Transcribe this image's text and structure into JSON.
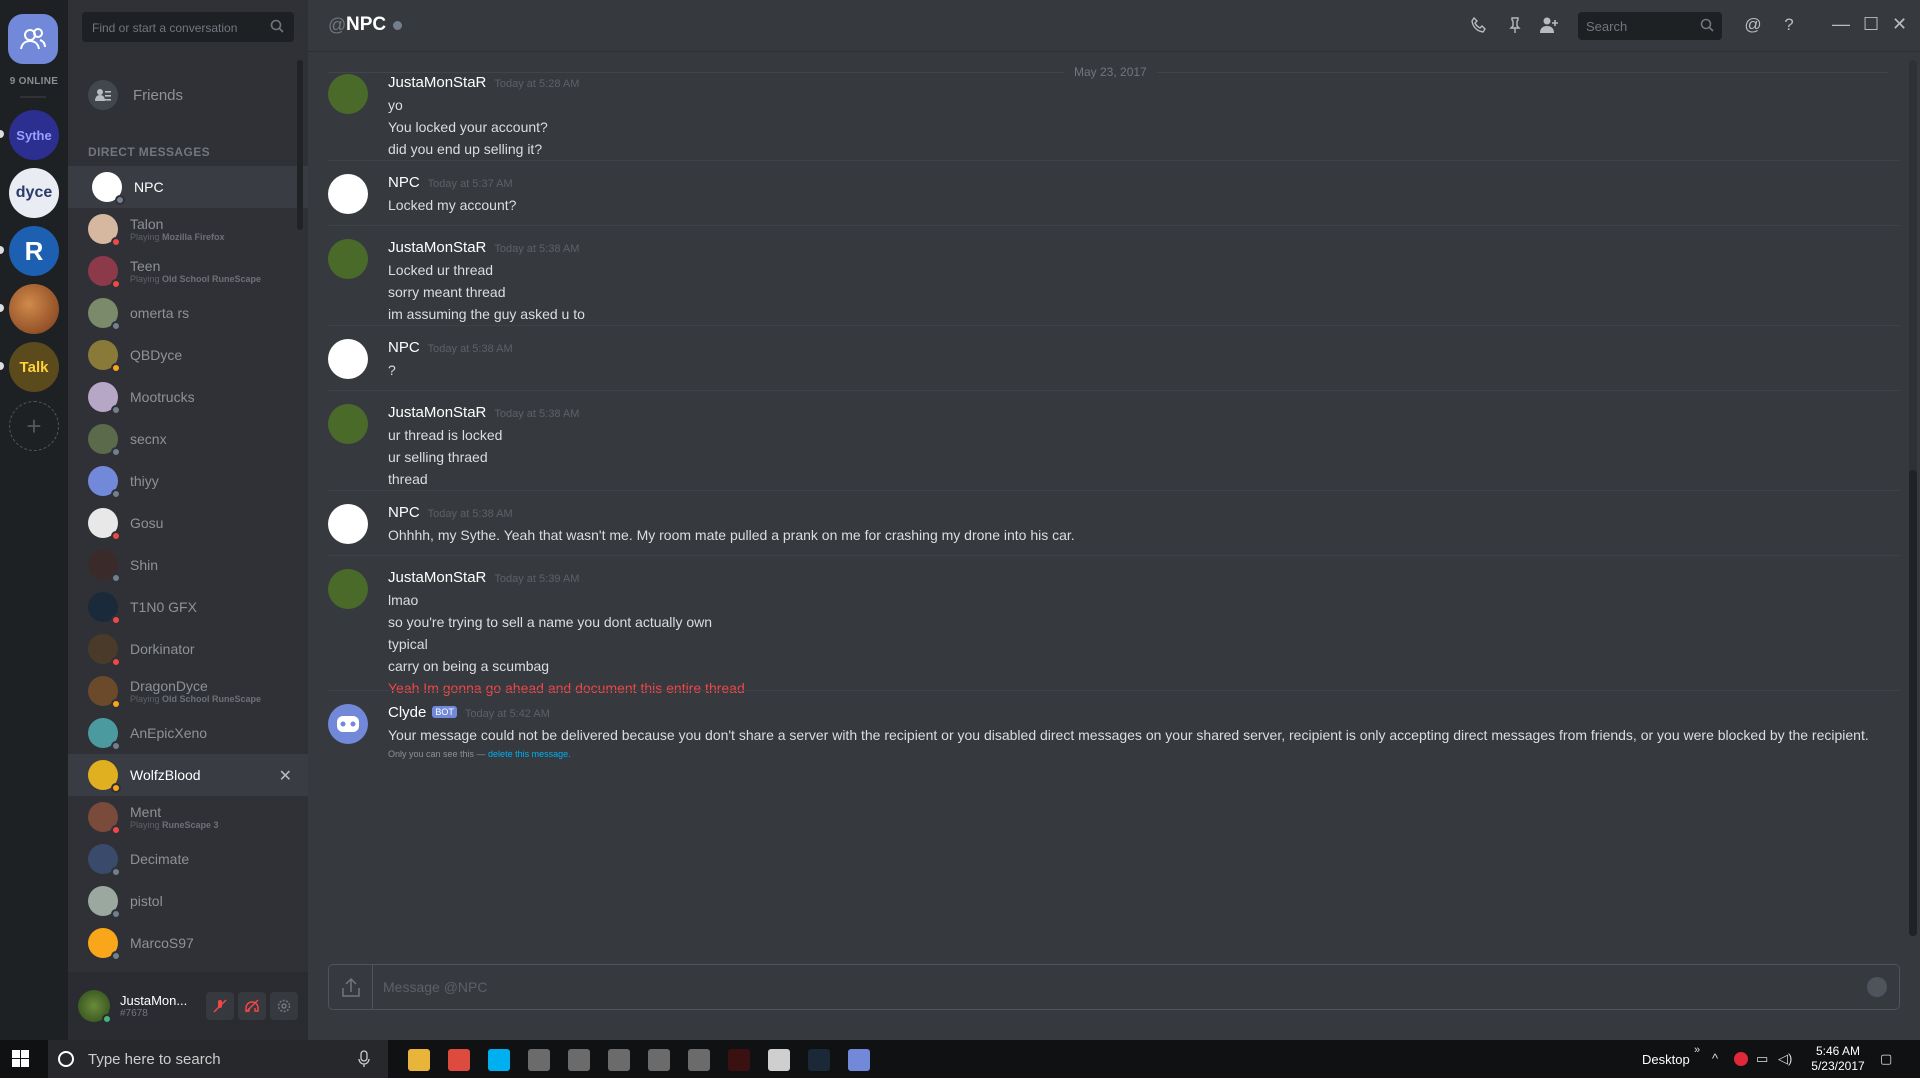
{
  "guilds": {
    "online_count": "9 ONLINE",
    "servers": [
      {
        "label": "Sythe",
        "color": "#2c2f8f"
      },
      {
        "label": "dyce",
        "color": "#e9ecf2"
      },
      {
        "label": "R",
        "color": "#1d5fb0"
      },
      {
        "label": "",
        "color": "#9b5b2c"
      },
      {
        "label": "Talk",
        "color": "#5a4a1c"
      }
    ]
  },
  "sidebar": {
    "search_placeholder": "Find or start a conversation",
    "friends_label": "Friends",
    "dm_header": "DIRECT MESSAGES",
    "dms": [
      {
        "name": "NPC",
        "sub": "",
        "game": "",
        "status": "#747f8d",
        "avatar": "#ffffff",
        "active": true
      },
      {
        "name": "Talon",
        "sub": "Playing ",
        "game": "Mozilla Firefox",
        "status": "#f04747",
        "avatar": "#d6b8a0"
      },
      {
        "name": "Teen",
        "sub": "Playing ",
        "game": "Old School RuneScape",
        "status": "#f04747",
        "avatar": "#8c3a4a"
      },
      {
        "name": "omerta rs",
        "sub": "",
        "game": "",
        "status": "#747f8d",
        "avatar": "#7a8a6a"
      },
      {
        "name": "QBDyce",
        "sub": "",
        "game": "",
        "status": "#faa61a",
        "avatar": "#8a7a3a"
      },
      {
        "name": "Mootrucks",
        "sub": "",
        "game": "",
        "status": "#747f8d",
        "avatar": "#b7a7c7"
      },
      {
        "name": "secnx",
        "sub": "",
        "game": "",
        "status": "#747f8d",
        "avatar": "#5a6a4a"
      },
      {
        "name": "thiyy",
        "sub": "",
        "game": "",
        "status": "#747f8d",
        "avatar": "#7289da"
      },
      {
        "name": "Gosu",
        "sub": "",
        "game": "",
        "status": "#f04747",
        "avatar": "#e8e8e8"
      },
      {
        "name": "Shin",
        "sub": "",
        "game": "",
        "status": "#747f8d",
        "avatar": "#3a2a2a"
      },
      {
        "name": "T1N0 GFX",
        "sub": "",
        "game": "",
        "status": "#f04747",
        "avatar": "#1a2a3a"
      },
      {
        "name": "Dorkinator",
        "sub": "",
        "game": "",
        "status": "#f04747",
        "avatar": "#4a3a2a"
      },
      {
        "name": "DragonDyce",
        "sub": "Playing ",
        "game": "Old School RuneScape",
        "status": "#faa61a",
        "avatar": "#6a4a2a"
      },
      {
        "name": "AnEpicXeno",
        "sub": "",
        "game": "",
        "status": "#747f8d",
        "avatar": "#4a9aa0"
      },
      {
        "name": "WolfzBlood",
        "sub": "",
        "game": "",
        "status": "#faa61a",
        "avatar": "#e0b020",
        "hover": true
      },
      {
        "name": "Ment",
        "sub": "Playing ",
        "game": "RuneScape 3",
        "status": "#f04747",
        "avatar": "#7a4a3a"
      },
      {
        "name": "Decimate",
        "sub": "",
        "game": "",
        "status": "#747f8d",
        "avatar": "#3a4a6a"
      },
      {
        "name": "pistol",
        "sub": "",
        "game": "",
        "status": "#747f8d",
        "avatar": "#9aa8a0"
      },
      {
        "name": "MarcoS97",
        "sub": "",
        "game": "",
        "status": "#747f8d",
        "avatar": "#faa61a"
      }
    ],
    "close_glyph": "✕"
  },
  "user_panel": {
    "name": "JustaMon...",
    "tag": "#7678"
  },
  "header": {
    "at": "@",
    "title": "NPC",
    "search_placeholder": "Search"
  },
  "date_divider": "May 23, 2017",
  "messages": [
    {
      "author": "JustaMonStaR",
      "time": "Today at 5:28 AM",
      "lines": [
        "yo",
        "You locked your account?",
        "did you end up selling it?"
      ],
      "avatar": "#4a6a2a"
    },
    {
      "author": "NPC",
      "time": "Today at 5:37 AM",
      "lines": [
        "Locked my account?"
      ],
      "avatar": "#ffffff"
    },
    {
      "author": "JustaMonStaR",
      "time": "Today at 5:38 AM",
      "lines": [
        "Locked ur thread",
        "sorry meant thread",
        "im assuming the guy asked u to"
      ],
      "avatar": "#4a6a2a"
    },
    {
      "author": "NPC",
      "time": "Today at 5:38 AM",
      "lines": [
        "?"
      ],
      "avatar": "#ffffff"
    },
    {
      "author": "JustaMonStaR",
      "time": "Today at 5:38 AM",
      "lines": [
        "ur thread is locked",
        "ur selling thraed",
        "thread"
      ],
      "avatar": "#4a6a2a"
    },
    {
      "author": "NPC",
      "time": "Today at 5:38 AM",
      "lines": [
        "Ohhhh, my Sythe. Yeah that wasn't me. My room mate pulled a prank on me for crashing my drone into his car."
      ],
      "avatar": "#ffffff"
    },
    {
      "author": "JustaMonStaR",
      "time": "Today at 5:39 AM",
      "lines": [
        "lmao",
        "so you're trying to sell a name you dont actually own",
        "typical",
        "carry on being a scumbag"
      ],
      "red_line": "Yeah Im gonna go ahead and document this entire thread",
      "avatar": "#4a6a2a"
    },
    {
      "author": "Clyde",
      "bot": "BOT",
      "time": "Today at 5:42 AM",
      "lines": [
        "Your message could not be delivered because you don't share a server with the recipient or you disabled direct messages on your shared server, recipient is only accepting direct messages from friends, or you were blocked by the recipient."
      ],
      "note_prefix": "Only you can see this — ",
      "note_link": "delete this message.",
      "avatar": "#7289da"
    }
  ],
  "composer": {
    "placeholder": "Message @NPC"
  },
  "taskbar": {
    "search_text": "Type here to search",
    "desktop_label": "Desktop",
    "time": "5:46 AM",
    "date": "5/23/2017",
    "apps": [
      {
        "name": "explorer",
        "color": "#e8b53a"
      },
      {
        "name": "chrome",
        "color": "#dd4b3e"
      },
      {
        "name": "skype",
        "color": "#00aff0"
      },
      {
        "name": "app-grid-1",
        "color": "#6b6b6b"
      },
      {
        "name": "app-grid-2",
        "color": "#6b6b6b"
      },
      {
        "name": "app-grid-3",
        "color": "#6b6b6b"
      },
      {
        "name": "app-grid-4",
        "color": "#6b6b6b"
      },
      {
        "name": "app-grid-5",
        "color": "#6b6b6b"
      },
      {
        "name": "osbuddy",
        "color": "#3a1010"
      },
      {
        "name": "calculator",
        "color": "#cfcfcf"
      },
      {
        "name": "steam",
        "color": "#1b2838"
      },
      {
        "name": "discord",
        "color": "#7289da"
      }
    ]
  }
}
